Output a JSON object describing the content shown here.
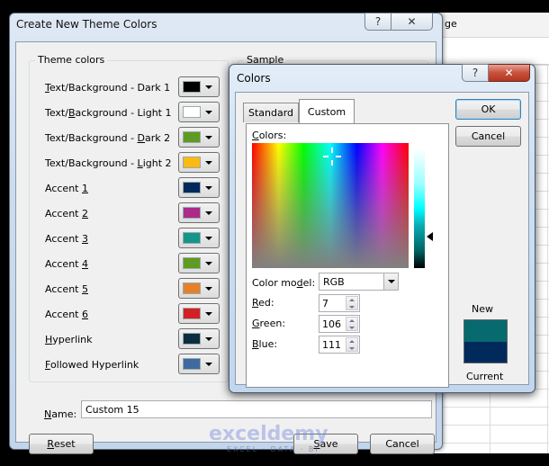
{
  "background_app": {
    "partial_text": "ge"
  },
  "theme_dialog": {
    "title": "Create New Theme Colors",
    "help_label": "?",
    "close_label": "✕",
    "theme_colors_group": "Theme colors",
    "sample_group": "Sample",
    "rows": [
      {
        "pre": "",
        "mnemonic": "T",
        "post": "ext/Background - Dark 1",
        "color": "#000000"
      },
      {
        "pre": "Text/",
        "mnemonic": "B",
        "post": "ackground - Light 1",
        "color": "#ffffff"
      },
      {
        "pre": "Text/Background - ",
        "mnemonic": "D",
        "post": "ark 2",
        "color": "#5f9a22"
      },
      {
        "pre": "Text/Background - ",
        "mnemonic": "L",
        "post": "ight 2",
        "color": "#fdb913"
      },
      {
        "pre": "Accent ",
        "mnemonic": "1",
        "post": "",
        "color": "#002a5c"
      },
      {
        "pre": "Accent ",
        "mnemonic": "2",
        "post": "",
        "color": "#ac2a8a"
      },
      {
        "pre": "Accent ",
        "mnemonic": "3",
        "post": "",
        "color": "#14958a"
      },
      {
        "pre": "Accent ",
        "mnemonic": "4",
        "post": "",
        "color": "#609a20"
      },
      {
        "pre": "Accent ",
        "mnemonic": "5",
        "post": "",
        "color": "#e6802b"
      },
      {
        "pre": "Accent ",
        "mnemonic": "6",
        "post": "",
        "color": "#d32024"
      },
      {
        "pre": "",
        "mnemonic": "H",
        "post": "yperlink",
        "color": "#0a2d40"
      },
      {
        "pre": "",
        "mnemonic": "F",
        "post": "ollowed Hyperlink",
        "color": "#3e6aa0"
      }
    ],
    "name_label_mnemonic": "N",
    "name_label_rest": "ame:",
    "name_value": "Custom 15",
    "reset_mnemonic": "R",
    "reset_rest": "eset",
    "save_mnemonic": "S",
    "save_rest": "ave",
    "cancel_label": "Cancel"
  },
  "colors_dialog": {
    "title": "Colors",
    "help_label": "?",
    "close_label": "✕",
    "tabs": [
      {
        "label": "Standard",
        "active": false
      },
      {
        "label": "Custom",
        "active": true
      }
    ],
    "colors_label_mnemonic": "C",
    "colors_label_rest": "olors:",
    "color_model_pre": "Color mo",
    "color_model_mnemonic": "d",
    "color_model_post": "el:",
    "color_model_value": "RGB",
    "red_label_mnemonic": "R",
    "red_label_rest": "ed:",
    "red_value": "7",
    "green_label_mnemonic": "G",
    "green_label_rest": "reen:",
    "green_value": "106",
    "blue_label_mnemonic": "B",
    "blue_label_rest": "lue:",
    "blue_value": "111",
    "ok_label": "OK",
    "cancel_label": "Cancel",
    "new_label": "New",
    "current_label": "Current",
    "new_color": "#076a6f",
    "current_color": "#002a5c"
  },
  "watermark": {
    "brand": "exceldemy",
    "tagline": "EXCEL · DATA · BI"
  }
}
